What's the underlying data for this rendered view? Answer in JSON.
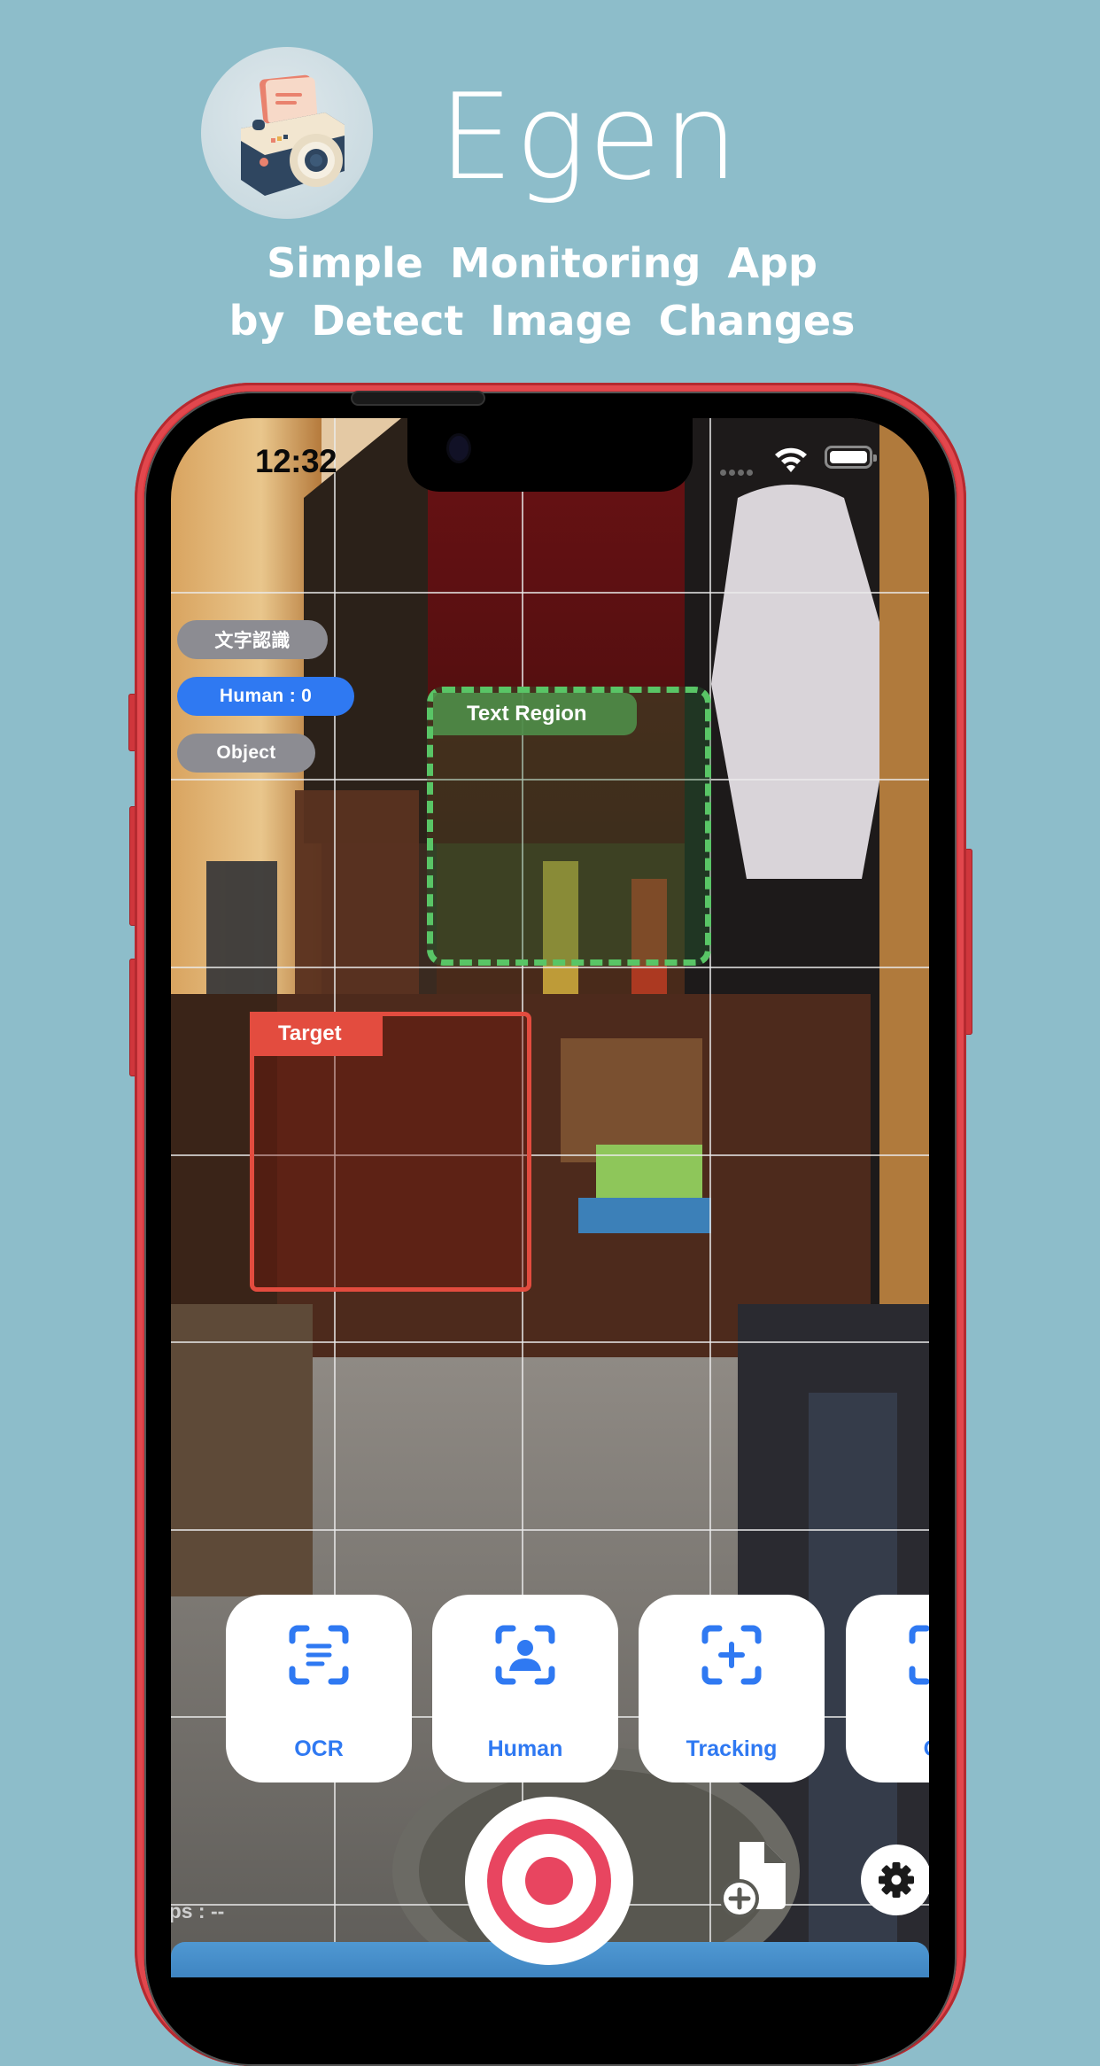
{
  "header": {
    "logo_icon": "camera-icon",
    "app_title": "Egen",
    "subtitle_line1": "Simple Monitoring App",
    "subtitle_line2": "by Detect Image Changes"
  },
  "status_bar": {
    "time": "12:32",
    "wifi_icon": "wifi-icon",
    "battery_icon": "battery-icon"
  },
  "mode_pills": [
    {
      "label": "文字認識",
      "active": false
    },
    {
      "label": "Human : 0",
      "active": true
    },
    {
      "label": "Object",
      "active": false
    }
  ],
  "overlays": {
    "text_region_label": "Text Region",
    "target_label": "Target"
  },
  "mode_cards": [
    {
      "label": "OCR",
      "icon": "text-scan-icon"
    },
    {
      "label": "Human",
      "icon": "person-scan-icon"
    },
    {
      "label": "Tracking",
      "icon": "crosshair-scan-icon"
    },
    {
      "label": "Ob",
      "icon": "object-scan-icon"
    }
  ],
  "fps_label": "fps : --",
  "controls": {
    "record_icon": "record-icon",
    "file_add_icon": "file-add-icon",
    "settings_icon": "gear-icon"
  },
  "colors": {
    "background": "#8dbdca",
    "accent_blue": "#2f79f2",
    "record_red": "#e84560",
    "text_region_green": "#59c566",
    "target_red": "#e34c3f",
    "phone_red": "#d8393f"
  }
}
